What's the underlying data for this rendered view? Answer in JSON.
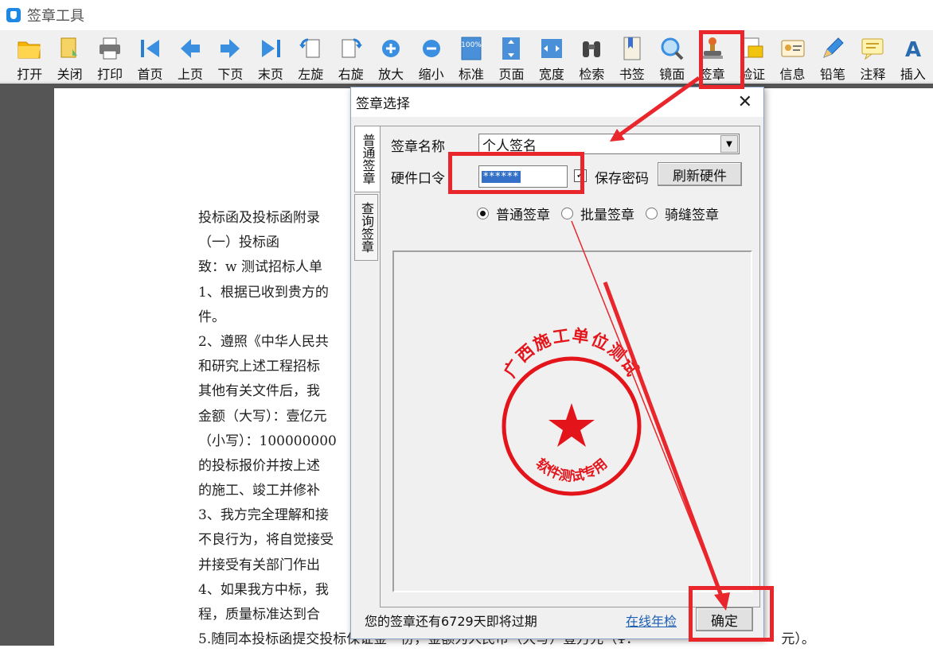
{
  "window": {
    "title": "签章工具"
  },
  "toolbar": {
    "items": [
      {
        "label": "打开",
        "icon": "open-folder-icon"
      },
      {
        "label": "关闭",
        "icon": "close-doc-icon"
      },
      {
        "label": "打印",
        "icon": "printer-icon"
      },
      {
        "label": "首页",
        "icon": "first-page-icon"
      },
      {
        "label": "上页",
        "icon": "prev-page-icon"
      },
      {
        "label": "下页",
        "icon": "next-page-icon"
      },
      {
        "label": "末页",
        "icon": "last-page-icon"
      },
      {
        "label": "左旋",
        "icon": "rotate-left-icon"
      },
      {
        "label": "右旋",
        "icon": "rotate-right-icon"
      },
      {
        "label": "放大",
        "icon": "zoom-in-icon"
      },
      {
        "label": "缩小",
        "icon": "zoom-out-icon"
      },
      {
        "label": "标准",
        "icon": "actual-size-icon",
        "icon_text": "100%"
      },
      {
        "label": "页面",
        "icon": "fit-page-icon"
      },
      {
        "label": "宽度",
        "icon": "fit-width-icon"
      },
      {
        "label": "检索",
        "icon": "binoculars-icon"
      },
      {
        "label": "书签",
        "icon": "bookmark-icon"
      },
      {
        "label": "镜面",
        "icon": "magnifier-icon"
      },
      {
        "label": "签章",
        "icon": "stamp-icon"
      },
      {
        "label": "验证",
        "icon": "verify-icon"
      },
      {
        "label": "信息",
        "icon": "info-card-icon"
      },
      {
        "label": "铅笔",
        "icon": "pencil-icon"
      },
      {
        "label": "注释",
        "icon": "comment-icon"
      },
      {
        "label": "插入",
        "icon": "insert-text-icon",
        "icon_text": "A"
      }
    ]
  },
  "document": {
    "lines": [
      "投标函及投标函附录",
      "（一）投标函",
      "致：w 测试招标人单",
      "1、根据已收到贵方的                                                                   文件及 有关附",
      "件。",
      "2、遵照《中华人民共                                                                    经考察现场",
      "和研究上述工程招标                                                                  、工程量清单及",
      "其他有关文件后，我",
      "金额（大写）：壹亿元",
      "（小写）：100000000",
      "的投标报价并按上述                                                                   承包 上述工程",
      "的施工、竣工并修补",
      "3、我方完全理解和接                                                                   标文 件列举的",
      "不良行为，将自觉接受                                                                  标资格的处理，",
      "并接受有关部门作出",
      "4、如果我方中标，我                                                                  ，并移 交本工",
      "程，质量标准达到合",
      "5.随同本投标函提交投标保证金一份，金额为人民币（大写）壹万元（¥：                                 元）。"
    ]
  },
  "dialog": {
    "title": "签章选择",
    "tabs": [
      "普通签章",
      "查询签章"
    ],
    "name_label": "签章名称",
    "name_value": "个人签名",
    "pwd_label": "硬件口令",
    "pwd_value": "******",
    "save_pwd_label": "保存密码",
    "save_pwd_checked": true,
    "refresh_button": "刷新硬件",
    "radio_options": [
      "普通签章",
      "批量签章",
      "骑缝签章"
    ],
    "radio_selected": 0,
    "seal": {
      "top_text": "广西施工单位测试",
      "bottom_text": "软件测试专用",
      "color": "#e4141b"
    },
    "status": "您的签章还有6729天即将过期",
    "online_link": "在线年检",
    "ok_button": "确定"
  },
  "highlight_color": "#e8262c"
}
